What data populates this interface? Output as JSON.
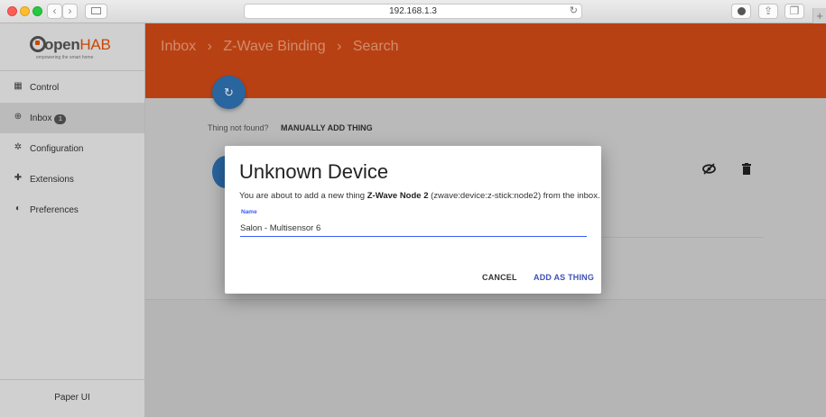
{
  "browser": {
    "url": "192.168.1.3",
    "back_glyph": "‹",
    "forward_glyph": "›",
    "new_tab_glyph": "+"
  },
  "sidebar": {
    "logo": {
      "open": "open",
      "hab": "HAB",
      "tagline": "empowering the smart home"
    },
    "items": [
      {
        "label": "Control",
        "icon": "dashboard-icon",
        "glyph": "▦"
      },
      {
        "label": "Inbox",
        "icon": "add-circle-icon",
        "glyph": "⊕",
        "badge": "1"
      },
      {
        "label": "Configuration",
        "icon": "gear-icon",
        "glyph": "✲"
      },
      {
        "label": "Extensions",
        "icon": "puzzle-icon",
        "glyph": "✚"
      },
      {
        "label": "Preferences",
        "icon": "contrast-icon",
        "glyph": "◐"
      }
    ],
    "footer": "Paper UI"
  },
  "header": {
    "breadcrumb": [
      "Inbox",
      "›",
      "Z-Wave Binding",
      "›",
      "Search"
    ]
  },
  "page": {
    "not_found_text": "Thing not found?",
    "manual_add": "MANUALLY ADD THING",
    "refresh_glyph": "↻"
  },
  "dialog": {
    "title": "Unknown Device",
    "text_before": "You are about to add a new thing ",
    "thing_name": "Z-Wave Node 2",
    "text_after": " (zwave:device:z-stick:node2) from the inbox.",
    "name_label": "Name",
    "name_value": "Salon - Multisensor 6",
    "cancel": "CANCEL",
    "confirm": "ADD AS THING"
  },
  "colors": {
    "header": "#d24a17",
    "accent": "#3f51b5",
    "fab": "#2f73b6"
  }
}
